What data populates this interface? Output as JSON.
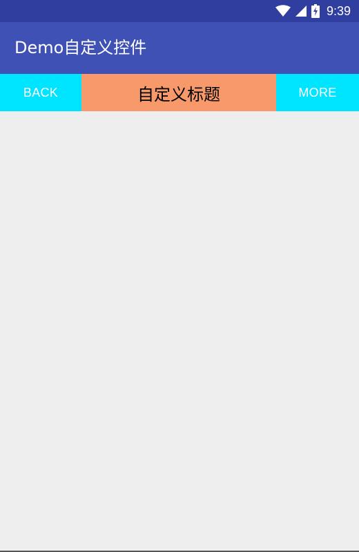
{
  "status_bar": {
    "time": "9:39",
    "icons": [
      "wifi-icon",
      "cell-signal-icon",
      "battery-charging-icon"
    ]
  },
  "app_bar": {
    "title": "Demo自定义控件"
  },
  "title_bar": {
    "back_label": "BACK",
    "title": "自定义标题",
    "more_label": "MORE"
  },
  "colors": {
    "status_bar": "#303f9f",
    "app_bar": "#3f51b5",
    "nav_button": "#00e5ff",
    "title_background": "#f7996a",
    "content_background": "#eeeeee"
  }
}
